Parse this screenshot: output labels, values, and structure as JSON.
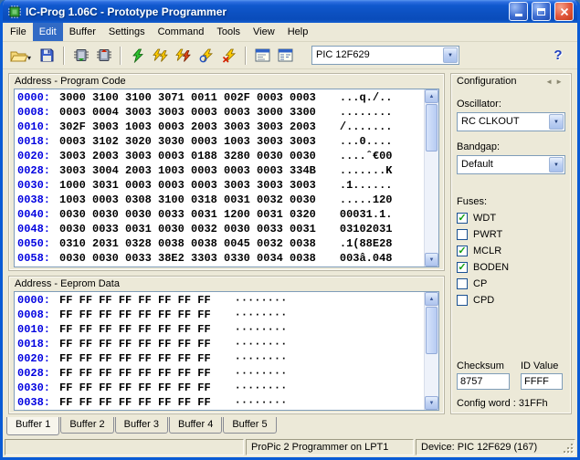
{
  "window": {
    "title": "IC-Prog 1.06C - Prototype Programmer"
  },
  "menu": {
    "items": [
      "File",
      "Edit",
      "Buffer",
      "Settings",
      "Command",
      "Tools",
      "View",
      "Help"
    ],
    "active": "Edit"
  },
  "toolbar": {
    "device_selector": "PIC 12F629",
    "icon_names": [
      "open-file",
      "open-dropdown",
      "save-file",
      "read-all",
      "program-all",
      "program-code",
      "verify",
      "program-data",
      "blank-check",
      "erase-all",
      "code-window",
      "assembler-window",
      "help"
    ]
  },
  "icons": {
    "up_arrow": "▲",
    "down_arrow": "▼",
    "left_arrow": "◄",
    "right_arrow": "►",
    "dropdown_arrow": "▼",
    "open_dropdown_arrow": "▾",
    "check": "✓",
    "help": "?"
  },
  "program_code": {
    "caption": "Address - Program Code",
    "rows": [
      {
        "addr": "0000:",
        "hex": "3000 3100 3100 3071 0011 002F 0003 0003",
        "ascii": "...q./.."
      },
      {
        "addr": "0008:",
        "hex": "0003 0004 3003 3003 0003 0003 3000 3300",
        "ascii": "........"
      },
      {
        "addr": "0010:",
        "hex": "302F 3003 1003 0003 2003 3003 3003 2003",
        "ascii": "/......."
      },
      {
        "addr": "0018:",
        "hex": "0003 3102 3020 3030 0003 1003 3003 3003",
        "ascii": "...0...."
      },
      {
        "addr": "0020:",
        "hex": "3003 2003 3003 0003 0188 3280 0030 0030",
        "ascii": "....ˆ€00"
      },
      {
        "addr": "0028:",
        "hex": "3003 3004 2003 1003 0003 0003 0003 334B",
        "ascii": ".......K"
      },
      {
        "addr": "0030:",
        "hex": "1000 3031 0003 0003 0003 3003 3003 3003",
        "ascii": ".1......"
      },
      {
        "addr": "0038:",
        "hex": "1003 0003 0308 3100 0318 0031 0032 0030",
        "ascii": ".....120"
      },
      {
        "addr": "0040:",
        "hex": "0030 0030 0030 0033 0031 1200 0031 0320",
        "ascii": "00031.1."
      },
      {
        "addr": "0048:",
        "hex": "0030 0033 0031 0030 0032 0030 0033 0031",
        "ascii": "03102031"
      },
      {
        "addr": "0050:",
        "hex": "0310 2031 0328 0038 0038 0045 0032 0038",
        "ascii": ".1(88E28"
      },
      {
        "addr": "0058:",
        "hex": "0030 0030 0033 38E2 3303 0330 0034 0038",
        "ascii": "003â.048"
      }
    ]
  },
  "eeprom": {
    "caption": "Address - Eeprom Data",
    "rows": [
      {
        "addr": "0000:",
        "hex": "FF FF FF FF FF FF FF FF",
        "ascii": "········"
      },
      {
        "addr": "0008:",
        "hex": "FF FF FF FF FF FF FF FF",
        "ascii": "········"
      },
      {
        "addr": "0010:",
        "hex": "FF FF FF FF FF FF FF FF",
        "ascii": "········"
      },
      {
        "addr": "0018:",
        "hex": "FF FF FF FF FF FF FF FF",
        "ascii": "········"
      },
      {
        "addr": "0020:",
        "hex": "FF FF FF FF FF FF FF FF",
        "ascii": "········"
      },
      {
        "addr": "0028:",
        "hex": "FF FF FF FF FF FF FF FF",
        "ascii": "········"
      },
      {
        "addr": "0030:",
        "hex": "FF FF FF FF FF FF FF FF",
        "ascii": "········"
      },
      {
        "addr": "0038:",
        "hex": "FF FF FF FF FF FF FF FF",
        "ascii": "········"
      }
    ]
  },
  "configuration": {
    "caption": "Configuration",
    "oscillator_label": "Oscillator:",
    "oscillator_value": "RC CLKOUT",
    "bandgap_label": "Bandgap:",
    "bandgap_value": "Default",
    "fuses_label": "Fuses:",
    "fuses": [
      {
        "label": "WDT",
        "checked": true
      },
      {
        "label": "PWRT",
        "checked": false
      },
      {
        "label": "MCLR",
        "checked": true
      },
      {
        "label": "BODEN",
        "checked": true
      },
      {
        "label": "CP",
        "checked": false
      },
      {
        "label": "CPD",
        "checked": false
      }
    ],
    "checksum_label": "Checksum",
    "checksum_value": "8757",
    "id_value_label": "ID Value",
    "id_value": "FFFF",
    "config_word": "Config word : 31FFh"
  },
  "tabs": {
    "items": [
      "Buffer 1",
      "Buffer 2",
      "Buffer 3",
      "Buffer 4",
      "Buffer 5"
    ],
    "active": "Buffer 1"
  },
  "statusbar": {
    "left": "",
    "programmer": "ProPic 2 Programmer on LPT1",
    "device": "Device: PIC 12F629  (167)"
  }
}
